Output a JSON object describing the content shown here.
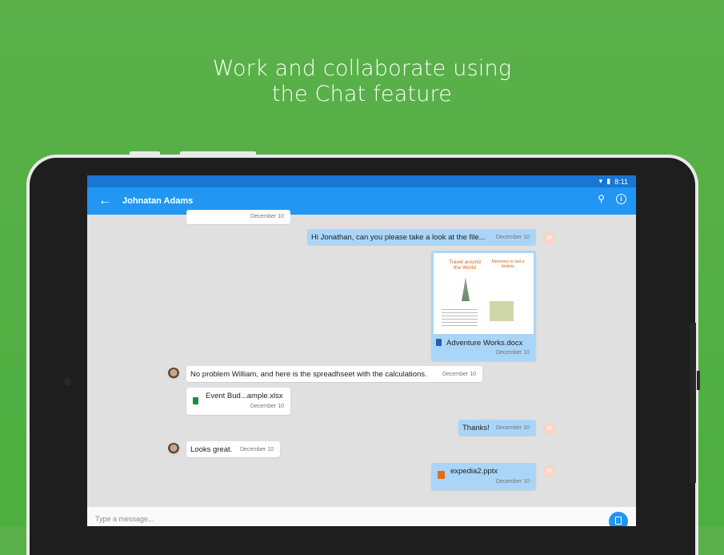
{
  "headline": {
    "line1": "Work and collaborate using",
    "line2": "the Chat feature"
  },
  "status": {
    "time": "8:11"
  },
  "appbar": {
    "contact_name": "Johnatan Adams"
  },
  "messages": [
    {
      "text": "",
      "time": "December 10"
    },
    {
      "text": "Hi Jonathan, can you please take a look at the file...",
      "time": "December 10",
      "avatar": "W"
    },
    {
      "file": "Adventure Works.docx",
      "time": "December 10",
      "preview": {
        "title": "Travel around the World",
        "right": "Memories to last a lifetime"
      }
    },
    {
      "text": "No problem William, and here is the spreadhseet with the calculations.",
      "time": "December 10"
    },
    {
      "file": "Event Bud...ample.xlsx",
      "time": "December 10"
    },
    {
      "text": "Thanks!",
      "time": "December 10",
      "avatar": "W"
    },
    {
      "text": "Looks great.",
      "time": "December 10"
    },
    {
      "file": "expedia2.pptx",
      "time": "December 10",
      "avatar": "W"
    }
  ],
  "input": {
    "placeholder": "Type a message..."
  },
  "icons": {
    "back": "arrow-left-icon",
    "search": "search-icon",
    "info": "info-icon",
    "attach": "document-icon"
  },
  "colors": {
    "background": "#4caf3f",
    "appbar": "#2196f3",
    "statusbar": "#1976d2",
    "my_bubble": "#a9d6f8"
  }
}
